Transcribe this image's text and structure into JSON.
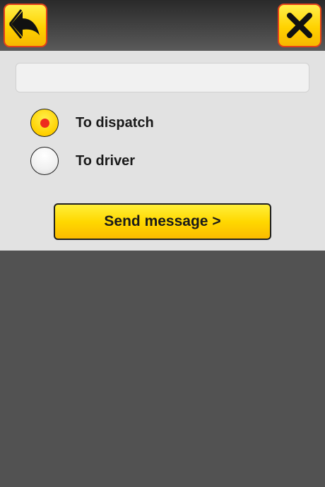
{
  "toolbar": {
    "back_icon": "back-arrow-icon",
    "close_icon": "close-x-icon",
    "button_color": "#ffd200",
    "button_border_color": "#e2401a"
  },
  "message": {
    "value": "",
    "placeholder": ""
  },
  "recipients": [
    {
      "label": "To dispatch",
      "selected": true
    },
    {
      "label": "To driver",
      "selected": false
    }
  ],
  "send_button": {
    "label": "Send message >"
  },
  "colors": {
    "accent": "#ffd800",
    "selected_dot": "#ee2a1e",
    "panel_bg": "#e2e2e2",
    "page_bg": "#525252"
  }
}
